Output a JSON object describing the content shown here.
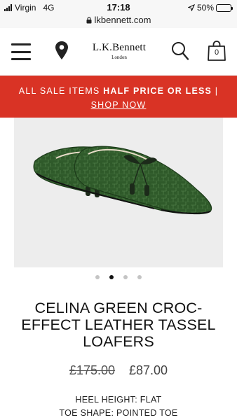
{
  "status": {
    "carrier": "Virgin",
    "network": "4G",
    "time": "17:18",
    "battery": "50%",
    "battery_level": 0.5,
    "url": "lkbennett.com"
  },
  "header": {
    "logo_name": "L.K.Bennett",
    "logo_sub": "London",
    "bag_count": "0"
  },
  "promo": {
    "prefix": "ALL SALE ITEMS ",
    "highlight": "HALF PRICE OR LESS",
    "separator": " |",
    "cta": "SHOP NOW"
  },
  "gallery": {
    "slide_count": 4,
    "active_slide": 2
  },
  "product": {
    "title": "CELINA GREEN CROC-EFFECT LEATHER TASSEL LOAFERS",
    "old_price": "£175.00",
    "price": "£87.00",
    "heel_height": "HEEL HEIGHT: FLAT",
    "toe_shape": "TOE SHAPE: POINTED TOE"
  },
  "colors": {
    "promo_bg": "#d93325",
    "shoe_green": "#2f5a2a"
  }
}
